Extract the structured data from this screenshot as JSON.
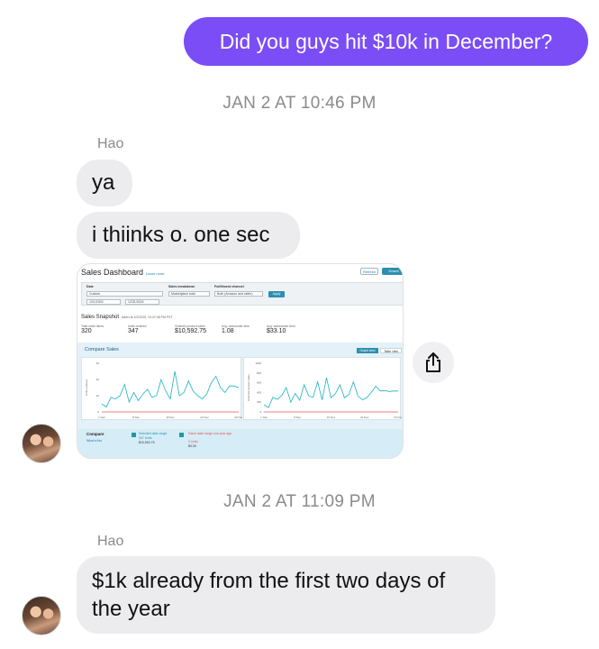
{
  "messages": {
    "outgoing_1": "Did you guys hit $10k in December?",
    "timestamp_1": "JAN 2 AT 10:46 PM",
    "sender_1": "Hao",
    "incoming_1": "ya",
    "incoming_2": "i thiinks o. one sec",
    "timestamp_2": "JAN 2 AT 11:09 PM",
    "sender_2": "Hao",
    "incoming_3_line1": "$1k already from the first two days of",
    "incoming_3_line2": "the year"
  },
  "screenshot": {
    "title": "Sales Dashboard",
    "learn_more": "Learn more",
    "refresh": "Refresh",
    "download": "Downl",
    "filters": {
      "date_label": "Date",
      "date_value": "Custom",
      "start_date": "12/1/2024",
      "end_date": "12/31/2024",
      "breakdown_label": "Sales breakdown",
      "breakdown_value": "Marketplace total",
      "channel_label": "Fulfillment channel",
      "channel_value": "Both (Amazon and seller)",
      "apply": "Apply"
    },
    "snapshot_title": "Sales Snapshot",
    "snapshot_taken": "taken at 1/2/2025, 10:47:08 PM PST",
    "metrics": [
      {
        "label": "Total order items",
        "value": "320"
      },
      {
        "label": "Units ordered",
        "value": "347"
      },
      {
        "label": "Ordered product sales",
        "value": "$10,592.75"
      },
      {
        "label": "Avg. units/order item",
        "value": "1.08"
      },
      {
        "label": "Avg. sales/order item",
        "value": "$33.10"
      }
    ],
    "compare_title": "Compare Sales",
    "graph_view": "Graph view",
    "table_view": "Table view",
    "left_axis_label": "Units ordered",
    "right_axis_label": "Ordered product sales",
    "x_ticks": [
      "1 Dec",
      "8 Dec",
      "15 Dec",
      "22 Dec",
      "30 Dec"
    ],
    "left_y_ticks": [
      "30",
      "20",
      "10",
      "0"
    ],
    "right_y_ticks": [
      "1000",
      "800",
      "600",
      "400",
      "200",
      "0"
    ],
    "legend": {
      "compare": "Compare",
      "whats_this": "What's this",
      "selected_range": "Selected date range",
      "selected_units": "347 Units",
      "selected_sales": "$10,592.75",
      "last_year_range": "Same date range one year ago",
      "last_year_units": "0 Units",
      "last_year_sales": "$0.00"
    },
    "colors": {
      "line": "#1ab3c4",
      "baseline": "#e8554e",
      "accent": "#2c8fae"
    }
  },
  "chart_data": [
    {
      "type": "line",
      "title": "",
      "ylabel": "Units ordered",
      "categories": [
        "1 Dec",
        "8 Dec",
        "15 Dec",
        "22 Dec",
        "30 Dec"
      ],
      "ylim": [
        0,
        30
      ],
      "series": [
        {
          "name": "Selected date range",
          "values": [
            5,
            3,
            9,
            8,
            10,
            17,
            6,
            12,
            7,
            11,
            14,
            9,
            10,
            20,
            13,
            8,
            25,
            10,
            12,
            19,
            13,
            10,
            8,
            11,
            18,
            22,
            15,
            12,
            16,
            16,
            15
          ]
        },
        {
          "name": "Same date range one year ago",
          "values": [
            0,
            0,
            0,
            0,
            0,
            0,
            0,
            0,
            0,
            0,
            0,
            0,
            0,
            0,
            0,
            0,
            0,
            0,
            0,
            0,
            0,
            0,
            0,
            0,
            0,
            0,
            0,
            0,
            0,
            0,
            0
          ]
        }
      ]
    },
    {
      "type": "line",
      "title": "",
      "ylabel": "Ordered product sales",
      "categories": [
        "1 Dec",
        "8 Dec",
        "15 Dec",
        "22 Dec",
        "30 Dec"
      ],
      "ylim": [
        0,
        1000
      ],
      "series": [
        {
          "name": "Selected date range",
          "values": [
            150,
            90,
            300,
            260,
            340,
            500,
            200,
            380,
            240,
            560,
            330,
            300,
            620,
            250,
            700,
            290,
            380,
            560,
            290,
            360,
            620,
            330,
            250,
            290,
            400,
            530,
            430,
            440,
            420,
            430,
            430
          ]
        },
        {
          "name": "Same date range one year ago",
          "values": [
            0,
            0,
            0,
            0,
            0,
            0,
            0,
            0,
            0,
            0,
            0,
            0,
            0,
            0,
            0,
            0,
            0,
            0,
            0,
            0,
            0,
            0,
            0,
            0,
            0,
            0,
            0,
            0,
            0,
            0,
            0
          ]
        }
      ]
    }
  ]
}
